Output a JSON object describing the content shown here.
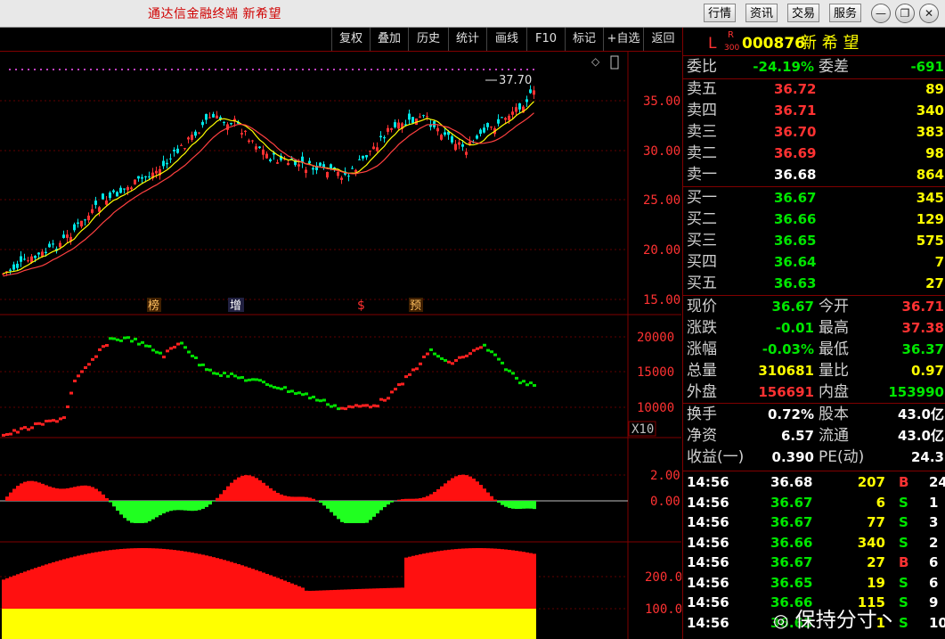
{
  "title": "通达信金融终端 新希望",
  "titlebar_buttons": [
    "行情",
    "资讯",
    "交易",
    "服务"
  ],
  "window_icons": [
    "minimize-icon",
    "restore-icon",
    "close-icon"
  ],
  "toolbar": [
    "复权",
    "叠加",
    "历史",
    "统计",
    "画线",
    "F10",
    "标记",
    "+自选",
    "返回"
  ],
  "stock": {
    "prefix": "L",
    "sub_top": "R",
    "sub_bottom": "300",
    "code": "000876",
    "name": "新 希 望"
  },
  "committee": {
    "ratio_label": "委比",
    "ratio": "-24.19%",
    "diff_label": "委差",
    "diff": "-691"
  },
  "asks": [
    {
      "label": "卖五",
      "price": "36.72",
      "vol": "89"
    },
    {
      "label": "卖四",
      "price": "36.71",
      "vol": "340"
    },
    {
      "label": "卖三",
      "price": "36.70",
      "vol": "383"
    },
    {
      "label": "卖二",
      "price": "36.69",
      "vol": "98"
    },
    {
      "label": "卖一",
      "price": "36.68",
      "vol": "864"
    }
  ],
  "bids": [
    {
      "label": "买一",
      "price": "36.67",
      "vol": "345"
    },
    {
      "label": "买二",
      "price": "36.66",
      "vol": "129"
    },
    {
      "label": "买三",
      "price": "36.65",
      "vol": "575"
    },
    {
      "label": "买四",
      "price": "36.64",
      "vol": "7"
    },
    {
      "label": "买五",
      "price": "36.63",
      "vol": "27"
    }
  ],
  "quote": [
    {
      "l1": "现价",
      "v1": "36.67",
      "c1": "green",
      "l2": "今开",
      "v2": "36.71",
      "c2": "red"
    },
    {
      "l1": "涨跌",
      "v1": "-0.01",
      "c1": "green",
      "l2": "最高",
      "v2": "37.38",
      "c2": "red"
    },
    {
      "l1": "涨幅",
      "v1": "-0.03%",
      "c1": "green",
      "l2": "最低",
      "v2": "36.37",
      "c2": "green"
    },
    {
      "l1": "总量",
      "v1": "310681",
      "c1": "yellow",
      "l2": "量比",
      "v2": "0.97",
      "c2": "yellow"
    },
    {
      "l1": "外盘",
      "v1": "156691",
      "c1": "red",
      "l2": "内盘",
      "v2": "153990",
      "c2": "green"
    }
  ],
  "fundamentals": [
    {
      "l1": "换手",
      "v1": "0.72%",
      "l2": "股本",
      "v2": "43.0亿"
    },
    {
      "l1": "净资",
      "v1": "6.57",
      "l2": "流通",
      "v2": "43.0亿"
    },
    {
      "l1": "收益(一)",
      "v1": "0.390",
      "l2": "PE(动)",
      "v2": "24.3"
    }
  ],
  "ticks": [
    {
      "time": "14:56",
      "price": "36.68",
      "pc": "white",
      "vol": "207",
      "flag": "B",
      "extra": "24"
    },
    {
      "time": "14:56",
      "price": "36.67",
      "pc": "green",
      "vol": "6",
      "flag": "S",
      "extra": "1"
    },
    {
      "time": "14:56",
      "price": "36.67",
      "pc": "green",
      "vol": "77",
      "flag": "S",
      "extra": "3"
    },
    {
      "time": "14:56",
      "price": "36.66",
      "pc": "green",
      "vol": "340",
      "flag": "S",
      "extra": "2"
    },
    {
      "time": "14:56",
      "price": "36.67",
      "pc": "green",
      "vol": "27",
      "flag": "B",
      "extra": "6"
    },
    {
      "time": "14:56",
      "price": "36.65",
      "pc": "green",
      "vol": "19",
      "flag": "S",
      "extra": "6"
    },
    {
      "time": "14:56",
      "price": "36.66",
      "pc": "green",
      "vol": "115",
      "flag": "S",
      "extra": "9"
    },
    {
      "time": "14:56",
      "price": "36.65",
      "pc": "green",
      "vol": "1",
      "flag": "S",
      "extra": "10"
    }
  ],
  "chart": {
    "main_axis": [
      "35.00",
      "30.00",
      "25.00",
      "20.00",
      "15.00"
    ],
    "vol_axis": [
      "20000",
      "15000",
      "10000"
    ],
    "vol_unit": "X10",
    "osc1_axis": [
      "2.00",
      "0.00"
    ],
    "osc2_axis": [
      "200.0",
      "100.0"
    ],
    "peak_label": "37.70",
    "event_tags": [
      "榜",
      "增",
      "$",
      "预"
    ]
  },
  "watermark": "保持分寸丶",
  "colors": {
    "up": "#ff3232",
    "down": "#00e6e6",
    "ma1": "#ffff00",
    "ma2": "#ff4040",
    "border": "#800000"
  }
}
